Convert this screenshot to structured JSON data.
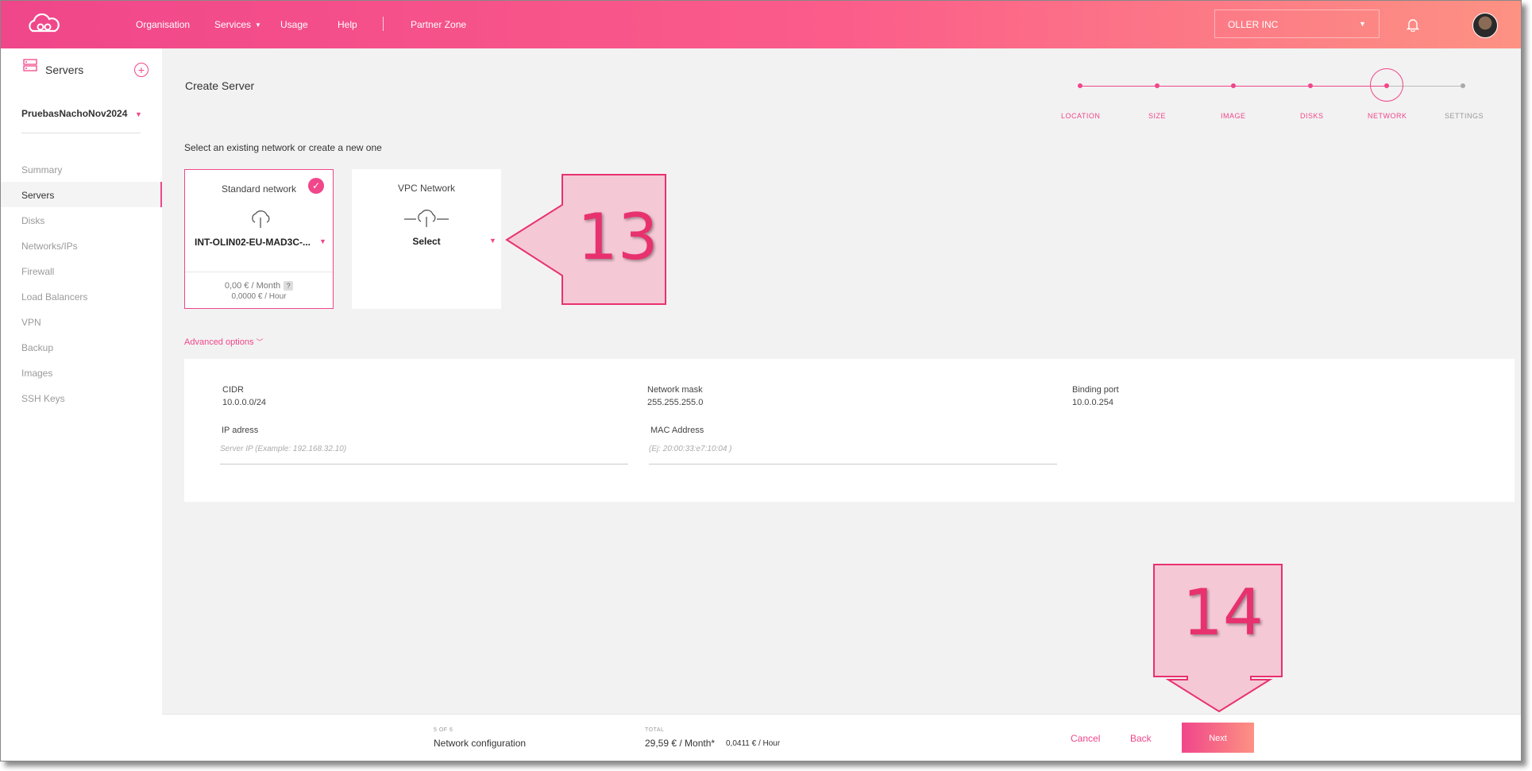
{
  "topbar": {
    "nav": [
      "Organisation",
      "Services",
      "Usage",
      "Help",
      "Partner Zone"
    ],
    "org": "OLLER INC"
  },
  "sidebar": {
    "title": "Servers",
    "project": "PruebasNachoNov2024",
    "items": [
      "Summary",
      "Servers",
      "Disks",
      "Networks/IPs",
      "Firewall",
      "Load Balancers",
      "VPN",
      "Backup",
      "Images",
      "SSH Keys"
    ],
    "active": "Servers"
  },
  "page": {
    "title": "Create Server",
    "instruction": "Select an existing network or create a new one",
    "steps": [
      "LOCATION",
      "SIZE",
      "IMAGE",
      "DISKS",
      "NETWORK",
      "SETTINGS"
    ],
    "current_step": "NETWORK"
  },
  "cards": {
    "standard": {
      "title": "Standard network",
      "value": "INT-OLIN02-EU-MAD3C-...",
      "price_month": "0,00 € / Month",
      "price_hour": "0,0000 € / Hour",
      "help": "?"
    },
    "vpc": {
      "title": "VPC Network",
      "value": "Select"
    }
  },
  "advanced": {
    "toggle_label": "Advanced options",
    "cidr_label": "CIDR",
    "cidr_value": "10.0.0.0/24",
    "mask_label": "Network mask",
    "mask_value": "255.255.255.0",
    "port_label": "Binding port",
    "port_value": "10.0.0.254",
    "ip_label": "IP adress",
    "ip_placeholder": "Server IP (Example: 192.168.32.10)",
    "mac_label": "MAC Address",
    "mac_placeholder": "(Ej: 20:00:33:e7:10:04 )"
  },
  "footer": {
    "step_count": "5 OF 6",
    "step_name": "Network configuration",
    "total_label": "TOTAL",
    "total_month": "29,59 € / Month*",
    "total_hour": "0,0411 € / Hour",
    "cancel": "Cancel",
    "back": "Back",
    "next": "Next"
  },
  "callouts": [
    "13",
    "14"
  ],
  "colors": {
    "accent": "#f0468a",
    "gradient_end": "#fd9283",
    "callout_fill": "#f5c8d6"
  }
}
